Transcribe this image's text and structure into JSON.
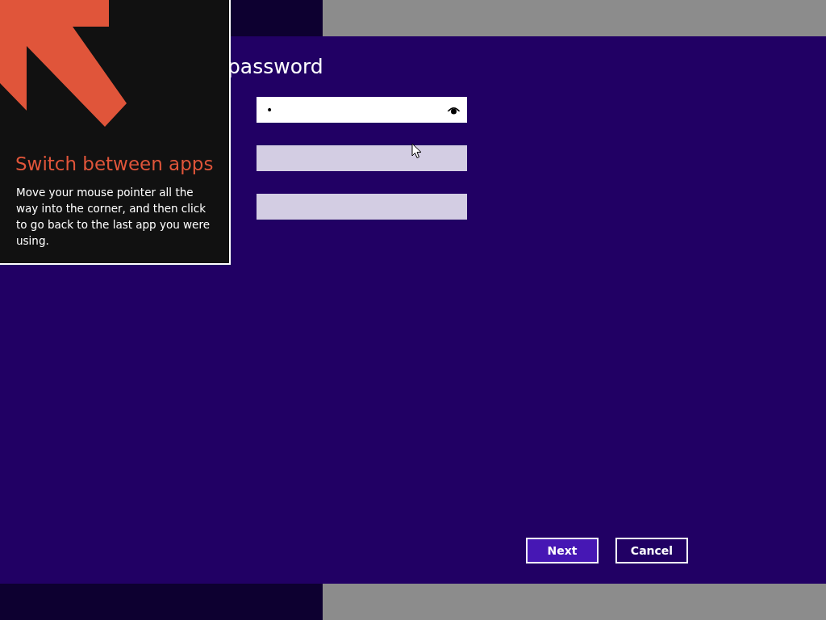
{
  "page": {
    "title": "password"
  },
  "fields": [
    {
      "value": "•",
      "focused": true
    },
    {
      "focused": false
    },
    {
      "focused": false
    }
  ],
  "buttons": [
    {
      "label": "Next",
      "default": true
    },
    {
      "label": "Cancel",
      "default": false
    }
  ],
  "tip": {
    "title": "Switch between apps",
    "text": "Move your mouse pointer all the way into the corner, and then click to go back to the last app you were using."
  }
}
